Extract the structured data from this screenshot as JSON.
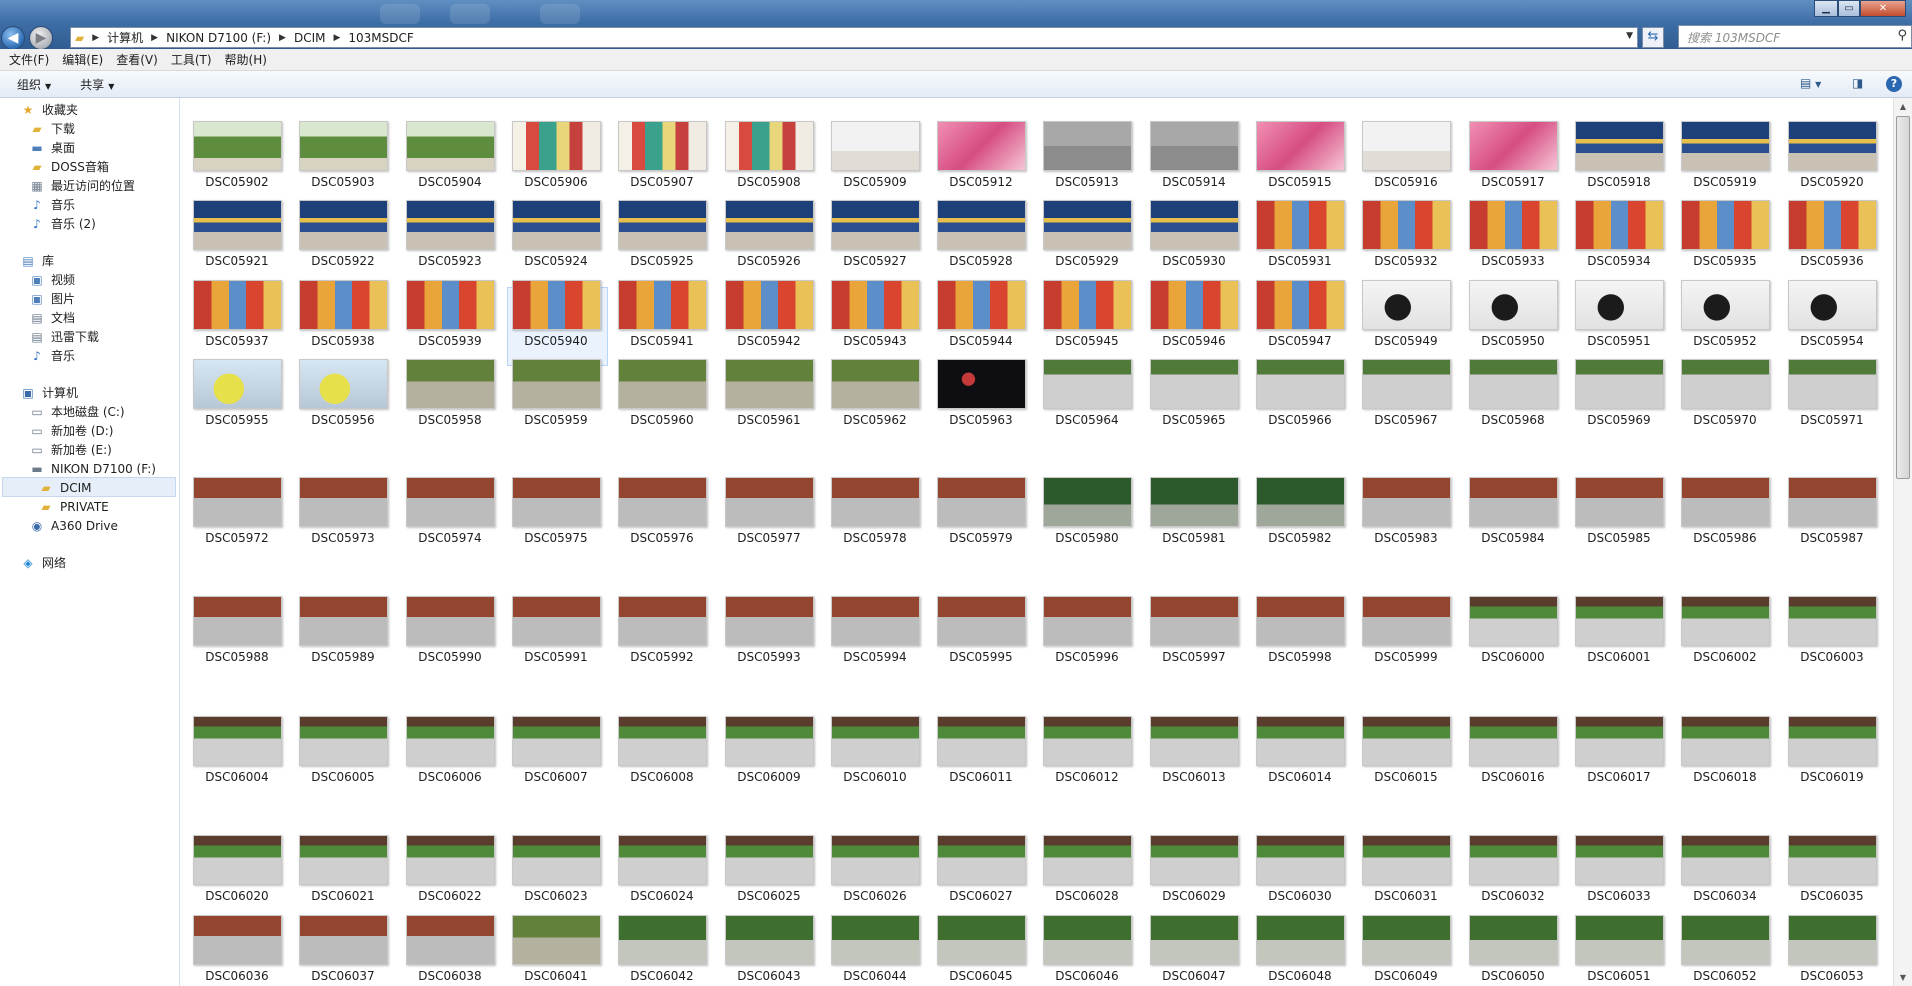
{
  "window": {
    "address_crumbs": [
      "计算机",
      "NIKON D7100 (F:)",
      "DCIM",
      "103MSDCF"
    ],
    "search_placeholder": "搜索 103MSDCF"
  },
  "menu": [
    "文件(F)",
    "编辑(E)",
    "查看(V)",
    "工具(T)",
    "帮助(H)"
  ],
  "commands": [
    "组织",
    "共享"
  ],
  "nav": {
    "favorites_label": "收藏夹",
    "favorites": [
      "下载",
      "桌面",
      "DOSS音箱",
      "最近访问的位置",
      "音乐",
      "音乐 (2)"
    ],
    "libraries_label": "库",
    "libraries": [
      "视频",
      "图片",
      "文档",
      "迅雷下载",
      "音乐"
    ],
    "computer_label": "计算机",
    "computer": [
      "本地磁盘 (C:)",
      "新加卷 (D:)",
      "新加卷 (E:)",
      "NIKON D7100 (F:)"
    ],
    "computer_sub": [
      "DCIM",
      "PRIVATE"
    ],
    "a360": "A360 Drive",
    "network_label": "网络",
    "selected": "DCIM"
  },
  "files": {
    "selected": "DSC05940",
    "rows": [
      [
        "DSC05902",
        "DSC05903",
        "DSC05904",
        "DSC05906",
        "DSC05907",
        "DSC05908",
        "DSC05909",
        "DSC05912",
        "DSC05913",
        "DSC05914",
        "DSC05915",
        "DSC05916",
        "DSC05917",
        "DSC05918",
        "DSC05919",
        "DSC05920"
      ],
      [
        "DSC05921",
        "DSC05922",
        "DSC05923",
        "DSC05924",
        "DSC05925",
        "DSC05926",
        "DSC05927",
        "DSC05928",
        "DSC05929",
        "DSC05930",
        "DSC05931",
        "DSC05932",
        "DSC05933",
        "DSC05934",
        "DSC05935",
        "DSC05936"
      ],
      [
        "DSC05937",
        "DSC05938",
        "DSC05939",
        "DSC05940",
        "DSC05941",
        "DSC05942",
        "DSC05943",
        "DSC05944",
        "DSC05945",
        "DSC05946",
        "DSC05947",
        "DSC05949",
        "DSC05950",
        "DSC05951",
        "DSC05952",
        "DSC05954"
      ],
      [
        "DSC05955",
        "DSC05956",
        "DSC05958",
        "DSC05959",
        "DSC05960",
        "DSC05961",
        "DSC05962",
        "DSC05963",
        "DSC05964",
        "DSC05965",
        "DSC05966",
        "DSC05967",
        "DSC05968",
        "DSC05969",
        "DSC05970",
        "DSC05971"
      ],
      [
        "DSC05972",
        "DSC05973",
        "DSC05974",
        "DSC05975",
        "DSC05976",
        "DSC05977",
        "DSC05978",
        "DSC05979",
        "DSC05980",
        "DSC05981",
        "DSC05982",
        "DSC05983",
        "DSC05984",
        "DSC05985",
        "DSC05986",
        "DSC05987"
      ],
      [
        "DSC05988",
        "DSC05989",
        "DSC05990",
        "DSC05991",
        "DSC05992",
        "DSC05993",
        "DSC05994",
        "DSC05995",
        "DSC05996",
        "DSC05997",
        "DSC05998",
        "DSC05999",
        "DSC06000",
        "DSC06001",
        "DSC06002",
        "DSC06003"
      ],
      [
        "DSC06004",
        "DSC06005",
        "DSC06006",
        "DSC06007",
        "DSC06008",
        "DSC06009",
        "DSC06010",
        "DSC06011",
        "DSC06012",
        "DSC06013",
        "DSC06014",
        "DSC06015",
        "DSC06016",
        "DSC06017",
        "DSC06018",
        "DSC06019"
      ],
      [
        "DSC06020",
        "DSC06021",
        "DSC06022",
        "DSC06023",
        "DSC06024",
        "DSC06025",
        "DSC06026",
        "DSC06027",
        "DSC06028",
        "DSC06029",
        "DSC06030",
        "DSC06031",
        "DSC06032",
        "DSC06033",
        "DSC06034",
        "DSC06035"
      ],
      [
        "DSC06036",
        "DSC06037",
        "DSC06038",
        "DSC06041",
        "DSC06042",
        "DSC06043",
        "DSC06044",
        "DSC06045",
        "DSC06046",
        "DSC06047",
        "DSC06048",
        "DSC06049",
        "DSC06050",
        "DSC06051",
        "DSC06052",
        "DSC06053"
      ]
    ],
    "palettes": [
      [
        "fruit",
        "fruit",
        "fruit",
        "red",
        "red",
        "red",
        "white",
        "pink",
        "grey",
        "grey",
        "pink",
        "white",
        "pink",
        "ceil",
        "ceil",
        "ceil"
      ],
      [
        "ceil",
        "ceil",
        "ceil",
        "ceil",
        "ceil",
        "ceil",
        "ceil",
        "ceil",
        "ceil",
        "ceil",
        "play",
        "play",
        "play",
        "play",
        "play",
        "play"
      ],
      [
        "play",
        "play",
        "play",
        "play",
        "play",
        "play",
        "play",
        "play",
        "play",
        "play",
        "play",
        "woman",
        "woman",
        "woman",
        "woman",
        "woman"
      ],
      [
        "yellow",
        "yellow",
        "park",
        "park",
        "park",
        "park",
        "park",
        "night",
        "court",
        "court",
        "court",
        "court",
        "court",
        "court",
        "court",
        "court"
      ],
      [
        "fence",
        "fence",
        "fence",
        "fence",
        "fence",
        "fence",
        "fence",
        "fence",
        "trees",
        "trees",
        "trees",
        "fence",
        "fence",
        "fence",
        "fence",
        "fence"
      ],
      [
        "fence",
        "fence",
        "fence",
        "fence",
        "fence",
        "fence",
        "fence",
        "fence",
        "fence",
        "fence",
        "fence",
        "fence",
        "bush",
        "bush",
        "bush",
        "bush"
      ],
      [
        "bush",
        "bush",
        "bush",
        "bush",
        "bush",
        "bush",
        "bush",
        "bush",
        "bush",
        "bush",
        "bush",
        "bush",
        "bush",
        "bush",
        "bush",
        "bush"
      ],
      [
        "bush",
        "bush",
        "bush",
        "bush",
        "bush",
        "bush",
        "bush",
        "bush",
        "bush",
        "bush",
        "bush",
        "bush",
        "bush",
        "bush",
        "bush",
        "bush"
      ],
      [
        "fence",
        "fence",
        "fence",
        "park",
        "green",
        "green",
        "green",
        "green",
        "green",
        "green",
        "green",
        "green",
        "green",
        "green",
        "green",
        "green"
      ]
    ]
  }
}
